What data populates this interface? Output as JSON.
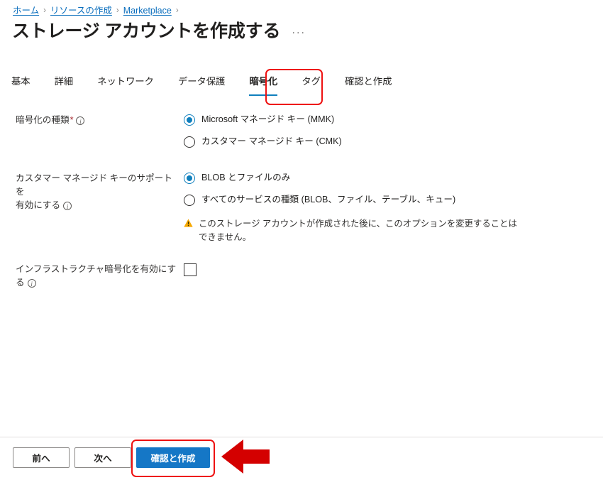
{
  "breadcrumb": {
    "items": [
      {
        "label": "ホーム"
      },
      {
        "label": "リソースの作成"
      },
      {
        "label": "Marketplace"
      }
    ],
    "separator": "›"
  },
  "header": {
    "title": "ストレージ アカウントを作成する",
    "more_label": "···"
  },
  "tabs": [
    {
      "label": "基本",
      "active": false
    },
    {
      "label": "詳細",
      "active": false
    },
    {
      "label": "ネットワーク",
      "active": false
    },
    {
      "label": "データ保護",
      "active": false
    },
    {
      "label": "暗号化",
      "active": true
    },
    {
      "label": "タグ",
      "active": false
    },
    {
      "label": "確認と作成",
      "active": false
    }
  ],
  "form": {
    "encryption_type": {
      "label": "暗号化の種類",
      "required_mark": "*",
      "options": [
        {
          "label": "Microsoft マネージド キー (MMK)",
          "checked": true
        },
        {
          "label": "カスタマー マネージド キー (CMK)",
          "checked": false
        }
      ]
    },
    "cmk_support": {
      "label_line1": "カスタマー マネージド キーのサポートを",
      "label_line2": "有効にする",
      "options": [
        {
          "label": "BLOB とファイルのみ",
          "checked": true
        },
        {
          "label": "すべてのサービスの種類 (BLOB、ファイル、テーブル、キュー)",
          "checked": false
        }
      ],
      "warning": "このストレージ アカウントが作成された後に、このオプションを変更することはできません。"
    },
    "infrastructure_encryption": {
      "label_line1": "インフラストラクチャ暗号化を有効にす",
      "label_line2": "る",
      "checked": false
    }
  },
  "footer": {
    "previous_label": "前へ",
    "next_label": "次へ",
    "review_create_label": "確認と作成"
  },
  "colors": {
    "accent_blue": "#0f7fbd",
    "link_blue": "#0a6ebd",
    "primary_button": "#1577c6",
    "annotation_red": "#ee1111",
    "warning_amber": "#f7a800",
    "required_red": "#a4262c"
  }
}
